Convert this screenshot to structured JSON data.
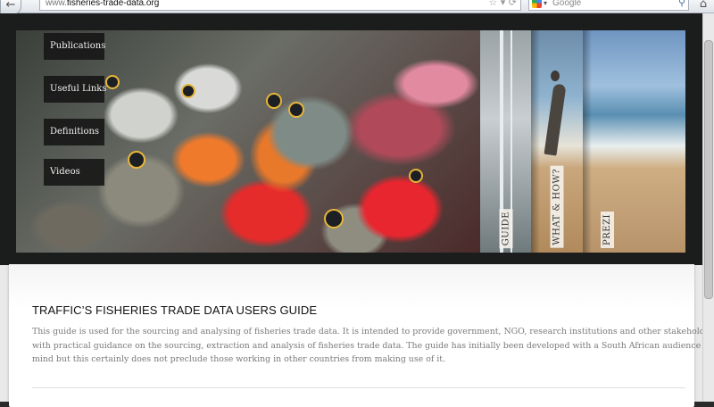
{
  "browser": {
    "back_icon": "back-arrow-icon",
    "url_prefix": "www.",
    "url_domain": "fisheries-trade-data.org",
    "search_placeholder": "Google",
    "home_icon": "home-icon"
  },
  "nav": {
    "items": [
      {
        "label": "Publications"
      },
      {
        "label": "Useful Links"
      },
      {
        "label": "Definitions"
      },
      {
        "label": "Videos"
      }
    ]
  },
  "panels": [
    {
      "label": "GUIDE"
    },
    {
      "label": "WHAT & HOW?"
    },
    {
      "label": "PREZI"
    }
  ],
  "main": {
    "title": "TRAFFIC’S FISHERIES TRADE DATA USERS GUIDE",
    "body_lines": [
      "This guide is used for the sourcing and analysing of fisheries trade data. It is intended to provide government, NGO, research institutions and other stakeholders",
      "with practical guidance on the sourcing, extraction and analysis of fisheries trade data.   The guide has initially been developed with a South African audience in",
      "mind but this certainly does not preclude those working in other countries from making use of it."
    ]
  }
}
